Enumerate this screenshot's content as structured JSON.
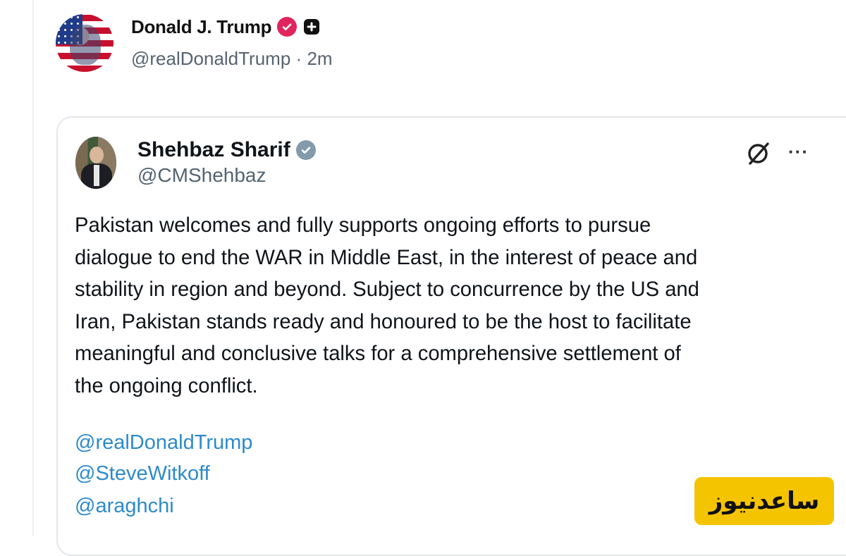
{
  "outer_post": {
    "display_name": "Donald J. Trump",
    "handle": "@realDonaldTrump",
    "separator": "·",
    "time_ago": "2m"
  },
  "quoted_post": {
    "display_name": "Shehbaz Sharif",
    "handle": "@CMShehbaz",
    "more_label": "···",
    "body_lines": [
      "Pakistan welcomes and fully supports ongoing efforts to pursue",
      "dialogue to end the WAR in Middle East, in the interest of peace and",
      "stability in region and beyond. Subject to concurrence by the US and",
      "Iran, Pakistan stands ready and honoured to be the host to facilitate",
      "meaningful and conclusive talks for a comprehensive settlement of",
      "the ongoing conflict."
    ],
    "mentions": [
      "@realDonaldTrump",
      "@SteveWitkoff",
      "@araghchi"
    ]
  },
  "watermark": {
    "text": "ساعدنیوز",
    "color": "#f5c400"
  },
  "colors": {
    "mention": "#2d8acb",
    "verified_pink": "#e0245e",
    "verified_gray": "#829aab"
  },
  "icons": [
    "verified-badge-icon",
    "square-badge-icon",
    "grok-icon",
    "more-icon"
  ]
}
